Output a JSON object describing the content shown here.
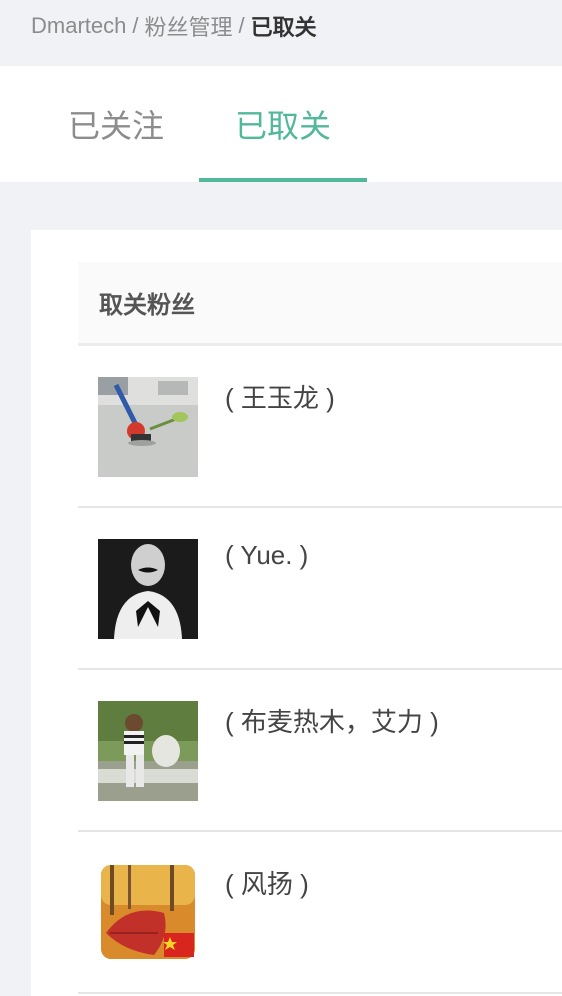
{
  "breadcrumb": {
    "items": [
      "Dmartech",
      "粉丝管理"
    ],
    "current": "已取关",
    "separator": "/"
  },
  "tabs": [
    {
      "label": "已关注",
      "active": false
    },
    {
      "label": "已取关",
      "active": true
    }
  ],
  "accent_color": "#52b89a",
  "table": {
    "header": "取关粉丝",
    "rows": [
      {
        "name": "( 王玉龙 )",
        "avatar": "robot-toy-photo"
      },
      {
        "name": "( Yue. )",
        "avatar": "mustache-portrait-photo"
      },
      {
        "name": "( 布麦热木，艾力 )",
        "avatar": "child-on-statue-photo"
      },
      {
        "name": "( 风扬 )",
        "avatar": "autumn-leaf-flag-photo"
      }
    ]
  }
}
